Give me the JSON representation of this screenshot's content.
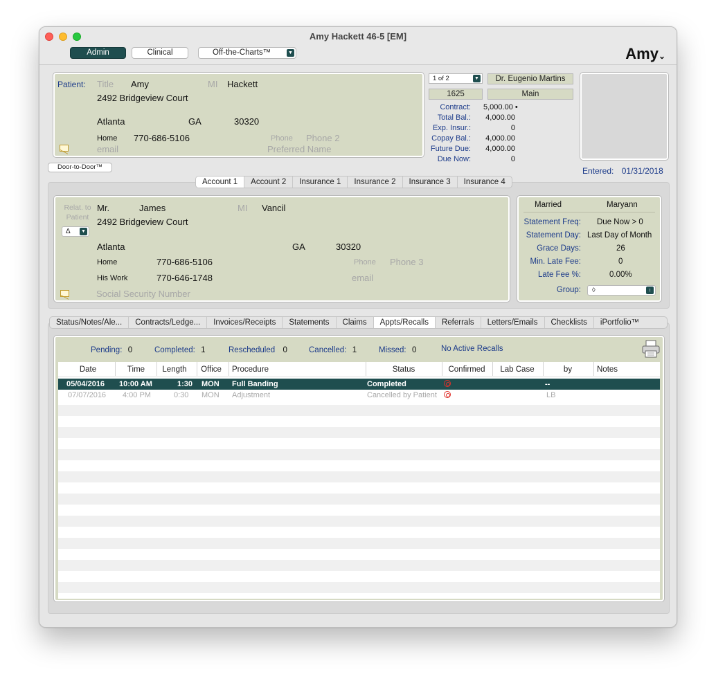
{
  "window": {
    "title": "Amy Hackett 46-5 [EM]"
  },
  "toolbar": {
    "admin": "Admin",
    "clinical": "Clinical",
    "off_the_charts": "Off-the-Charts™",
    "user": "Amy"
  },
  "patient": {
    "label": "Patient:",
    "title_placeholder": "Title",
    "first": "Amy",
    "mi_placeholder": "MI",
    "last": "Hackett",
    "address": "2492 Bridgeview Court",
    "city": "Atlanta",
    "state": "GA",
    "zip": "30320",
    "phone_type": "Home",
    "phone": "770-686-5106",
    "phone_placeholder": "Phone",
    "phone2_placeholder": "Phone 2",
    "email_placeholder": "email",
    "preferred_placeholder": "Preferred Name"
  },
  "account_meta": {
    "pager": "1 of 2",
    "doctor": "Dr. Eugenio Martins",
    "account_no": "1625",
    "location": "Main"
  },
  "financial": [
    {
      "label": "Contract:",
      "value": "5,000.00 •"
    },
    {
      "label": "Total Bal.:",
      "value": "4,000.00"
    },
    {
      "label": "Exp. Insur.:",
      "value": "0"
    },
    {
      "label": "Copay Bal.:",
      "value": "4,000.00"
    },
    {
      "label": "Future Due:",
      "value": "4,000.00"
    },
    {
      "label": "Due Now:",
      "value": "0"
    }
  ],
  "entered": {
    "label": "Entered:",
    "value": "01/31/2018"
  },
  "door_button": "Door-to-Door™",
  "account_tabs": [
    "Account 1",
    "Account 2",
    "Insurance 1",
    "Insurance 2",
    "Insurance 3",
    "Insurance 4"
  ],
  "responsible": {
    "relat_label": "Relat. to Patient",
    "relat_value": "Δ",
    "title": "Mr.",
    "first": "James",
    "mi_placeholder": "MI",
    "last": "Vancil",
    "address": "2492 Bridgeview Court",
    "city": "Atlanta",
    "state": "GA",
    "zip": "30320",
    "phone1_type": "Home",
    "phone1": "770-686-5106",
    "phone2_type": "His Work",
    "phone2": "770-646-1748",
    "phone_placeholder": "Phone",
    "phone3_placeholder": "Phone 3",
    "email_placeholder": "email",
    "ssn_placeholder": "Social Security Number"
  },
  "billing": {
    "marital": "Married",
    "spouse": "Maryann",
    "rows": [
      {
        "label": "Statement Freq:",
        "value": "Due Now > 0"
      },
      {
        "label": "Statement Day:",
        "value": "Last Day of Month"
      },
      {
        "label": "Grace Days:",
        "value": "26"
      },
      {
        "label": "Min. Late Fee:",
        "value": "0"
      },
      {
        "label": "Late Fee %:",
        "value": "0.00%"
      }
    ],
    "group_label": "Group:",
    "group_value": "◊"
  },
  "main_tabs": [
    "Status/Notes/Ale...",
    "Contracts/Ledge...",
    "Invoices/Receipts",
    "Statements",
    "Claims",
    "Appts/Recalls",
    "Referrals",
    "Letters/Emails",
    "Checklists",
    "iPortfolio™"
  ],
  "appt_stats": {
    "pending_label": "Pending:",
    "pending": "0",
    "completed_label": "Completed:",
    "completed": "1",
    "rescheduled_label": "Rescheduled",
    "rescheduled": "0",
    "cancelled_label": "Cancelled:",
    "cancelled": "1",
    "missed_label": "Missed:",
    "missed": "0",
    "recalls": "No Active Recalls"
  },
  "grid": {
    "headers": [
      "Date",
      "Time",
      "Length",
      "Office",
      "Procedure",
      "Status",
      "Confirmed",
      "Lab Case",
      "by",
      "Notes"
    ],
    "rows": [
      {
        "date": "05/04/2016",
        "time": "10:00 AM",
        "length": "1:30",
        "office": "MON",
        "procedure": "Full Banding",
        "status": "Completed",
        "by": "--"
      },
      {
        "date": "07/07/2016",
        "time": "4:00 PM",
        "length": "0:30",
        "office": "MON",
        "procedure": "Adjustment",
        "status": "Cancelled by Patient",
        "by": "LB"
      }
    ]
  }
}
